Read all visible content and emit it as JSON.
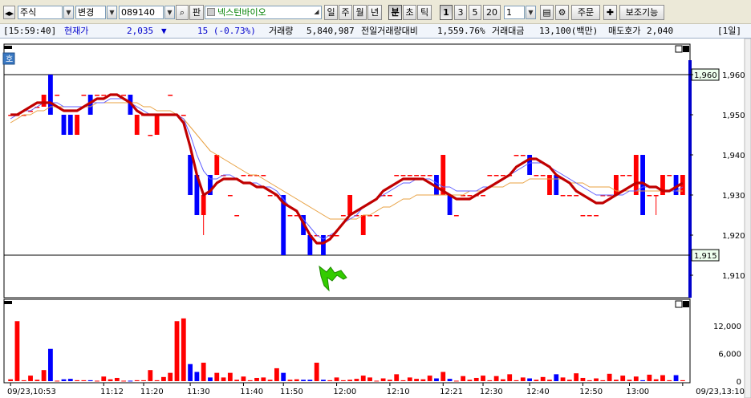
{
  "toolbar": {
    "market": "주식",
    "mode": "변경",
    "code": "089140",
    "pan": "판",
    "stock_name": "넥스턴바이오",
    "period_buttons": [
      "일",
      "주",
      "월",
      "년",
      "분",
      "초",
      "틱"
    ],
    "active_period": "분",
    "interval_buttons": [
      "1",
      "3",
      "5",
      "20"
    ],
    "active_interval": "1",
    "count_value": "1",
    "order_label": "주문",
    "aux_label": "보조기능"
  },
  "info": {
    "time": "[15:59:40]",
    "price_label": "현재가",
    "price": "2,035",
    "change_arrow": "▼",
    "change": "15 (-0.73%)",
    "volume_label": "거래량",
    "volume": "5,840,987",
    "prev_ratio_label": "전일거래량대비",
    "prev_ratio": "1,559.76%",
    "amount_label": "거래대금",
    "amount": "13,100(백만)",
    "ask_label": "매도호가",
    "ask": "2,040",
    "tab": "[1일]"
  },
  "chart_badge": "호",
  "colors": {
    "up": "#ff0000",
    "down": "#0000ff",
    "ma_main": "#c00000",
    "ma_fast": "#6060ff",
    "ma_slow": "#e8a040",
    "arrow": "#33cc00"
  },
  "chart_data": {
    "type": "candlestick",
    "price_ticks": [
      "1,960",
      "1,950",
      "1,940",
      "1,930",
      "1,920",
      "1,910"
    ],
    "price_tick_values": [
      1960,
      1950,
      1940,
      1930,
      1920,
      1910
    ],
    "hline_labels": [
      "1,960",
      "1,915"
    ],
    "hline_values": [
      1960,
      1915
    ],
    "ylim": [
      1905,
      1967
    ],
    "volume_ticks": [
      "12,000",
      "6,000",
      "0"
    ],
    "volume_tick_values": [
      12000,
      6000,
      0
    ],
    "vol_ylim": [
      0,
      16000
    ],
    "time_labels": [
      "09/23,10:53",
      "11:12",
      "11:20",
      "11:30",
      "11:40",
      "11:50",
      "12:00",
      "12:10",
      "12:21",
      "12:30",
      "12:40",
      "12:50",
      "13:00",
      "09/23,13:10"
    ],
    "time_label_index": [
      0,
      14,
      20,
      27,
      35,
      41,
      49,
      57,
      65,
      71,
      78,
      86,
      93,
      101
    ],
    "candles": [
      [
        1950,
        1950,
        1950,
        1950
      ],
      [
        1950,
        1950,
        1950,
        1950
      ],
      [
        1950,
        1950,
        1950,
        1950
      ],
      [
        1951,
        1951,
        1951,
        1951
      ],
      [
        1952,
        1952,
        1952,
        1952
      ],
      [
        1952,
        1955,
        1952,
        1955
      ],
      [
        1960,
        1960,
        1950,
        1950
      ],
      [
        1955,
        1955,
        1955,
        1955
      ],
      [
        1950,
        1950,
        1945,
        1945
      ],
      [
        1950,
        1950,
        1945,
        1945
      ],
      [
        1945,
        1950,
        1945,
        1950
      ],
      [
        1955,
        1955,
        1955,
        1955
      ],
      [
        1955,
        1955,
        1950,
        1950
      ],
      [
        1955,
        1955,
        1955,
        1955
      ],
      [
        1955,
        1955,
        1955,
        1955
      ],
      [
        1955,
        1955,
        1955,
        1955
      ],
      [
        1955,
        1955,
        1955,
        1955
      ],
      [
        1955,
        1955,
        1955,
        1955
      ],
      [
        1955,
        1955,
        1950,
        1950
      ],
      [
        1945,
        1950,
        1945,
        1950
      ],
      [
        1950,
        1950,
        1950,
        1950
      ],
      [
        1945,
        1945,
        1945,
        1945
      ],
      [
        1945,
        1950,
        1945,
        1950
      ],
      [
        1950,
        1950,
        1950,
        1950
      ],
      [
        1955,
        1955,
        1955,
        1955
      ],
      [
        1950,
        1950,
        1950,
        1950
      ],
      [
        1950,
        1950,
        1950,
        1950
      ],
      [
        1940,
        1940,
        1930,
        1930
      ],
      [
        1935,
        1935,
        1925,
        1925
      ],
      [
        1925,
        1930,
        1920,
        1930
      ],
      [
        1935,
        1935,
        1930,
        1930
      ],
      [
        1935,
        1940,
        1935,
        1940
      ],
      [
        1935,
        1935,
        1935,
        1935
      ],
      [
        1930,
        1930,
        1930,
        1930
      ],
      [
        1925,
        1925,
        1925,
        1925
      ],
      [
        1935,
        1935,
        1935,
        1935
      ],
      [
        1935,
        1935,
        1935,
        1935
      ],
      [
        1935,
        1935,
        1935,
        1935
      ],
      [
        1935,
        1935,
        1935,
        1935
      ],
      [
        1930,
        1930,
        1930,
        1930
      ],
      [
        1930,
        1930,
        1930,
        1930
      ],
      [
        1930,
        1930,
        1915,
        1915
      ],
      [
        1925,
        1925,
        1925,
        1925
      ],
      [
        1925,
        1925,
        1925,
        1925
      ],
      [
        1925,
        1925,
        1920,
        1920
      ],
      [
        1920,
        1920,
        1915,
        1915
      ],
      [
        1920,
        1920,
        1920,
        1920
      ],
      [
        1920,
        1920,
        1915,
        1915
      ],
      [
        1920,
        1920,
        1920,
        1920
      ],
      [
        1920,
        1920,
        1920,
        1920
      ],
      [
        1925,
        1925,
        1925,
        1925
      ],
      [
        1925,
        1930,
        1925,
        1930
      ],
      [
        1925,
        1925,
        1925,
        1925
      ],
      [
        1920,
        1925,
        1920,
        1925
      ],
      [
        1925,
        1925,
        1925,
        1925
      ],
      [
        1925,
        1925,
        1925,
        1925
      ],
      [
        1930,
        1930,
        1930,
        1930
      ],
      [
        1930,
        1930,
        1930,
        1930
      ],
      [
        1935,
        1935,
        1935,
        1935
      ],
      [
        1935,
        1935,
        1935,
        1935
      ],
      [
        1935,
        1935,
        1935,
        1935
      ],
      [
        1935,
        1935,
        1935,
        1935
      ],
      [
        1935,
        1935,
        1935,
        1935
      ],
      [
        1935,
        1935,
        1935,
        1935
      ],
      [
        1935,
        1935,
        1930,
        1930
      ],
      [
        1930,
        1940,
        1930,
        1940
      ],
      [
        1930,
        1930,
        1925,
        1925
      ],
      [
        1925,
        1925,
        1925,
        1925
      ],
      [
        1930,
        1930,
        1930,
        1930
      ],
      [
        1930,
        1930,
        1930,
        1930
      ],
      [
        1930,
        1930,
        1930,
        1930
      ],
      [
        1930,
        1930,
        1930,
        1930
      ],
      [
        1935,
        1935,
        1935,
        1935
      ],
      [
        1935,
        1935,
        1935,
        1935
      ],
      [
        1935,
        1935,
        1935,
        1935
      ],
      [
        1935,
        1935,
        1935,
        1935
      ],
      [
        1940,
        1940,
        1940,
        1940
      ],
      [
        1940,
        1940,
        1940,
        1940
      ],
      [
        1940,
        1940,
        1935,
        1935
      ],
      [
        1935,
        1935,
        1935,
        1935
      ],
      [
        1935,
        1935,
        1935,
        1935
      ],
      [
        1930,
        1935,
        1930,
        1935
      ],
      [
        1935,
        1935,
        1930,
        1930
      ],
      [
        1930,
        1930,
        1930,
        1930
      ],
      [
        1930,
        1930,
        1930,
        1930
      ],
      [
        1930,
        1930,
        1930,
        1930
      ],
      [
        1925,
        1925,
        1925,
        1925
      ],
      [
        1925,
        1925,
        1925,
        1925
      ],
      [
        1925,
        1925,
        1925,
        1925
      ],
      [
        1930,
        1930,
        1930,
        1930
      ],
      [
        1930,
        1930,
        1930,
        1930
      ],
      [
        1930,
        1935,
        1930,
        1935
      ],
      [
        1935,
        1935,
        1935,
        1935
      ],
      [
        1935,
        1935,
        1935,
        1935
      ],
      [
        1930,
        1940,
        1930,
        1940
      ],
      [
        1940,
        1940,
        1925,
        1925
      ],
      [
        1930,
        1930,
        1930,
        1930
      ],
      [
        1930,
        1930,
        1925,
        1930
      ],
      [
        1930,
        1935,
        1930,
        1935
      ],
      [
        1935,
        1935,
        1935,
        1935
      ],
      [
        1935,
        1935,
        1930,
        1930
      ],
      [
        1930,
        1935,
        1930,
        1935
      ]
    ],
    "volumes": [
      400,
      13000,
      200,
      1200,
      300,
      2400,
      7000,
      100,
      400,
      500,
      200,
      200,
      200,
      100,
      1000,
      400,
      700,
      100,
      100,
      200,
      200,
      2400,
      200,
      900,
      1800,
      13000,
      13600,
      3700,
      2000,
      4000,
      800,
      1800,
      800,
      1800,
      300,
      1000,
      200,
      700,
      800,
      300,
      2800,
      1800,
      300,
      400,
      300,
      300,
      4000,
      300,
      200,
      800,
      200,
      300,
      500,
      1200,
      800,
      100,
      600,
      300,
      1500,
      200,
      800,
      500,
      400,
      1200,
      600,
      2000,
      500,
      100,
      1100,
      300,
      700,
      1200,
      200,
      1100,
      400,
      1500,
      200,
      800,
      600,
      300,
      900,
      300,
      1500,
      800,
      300,
      1700,
      700,
      200,
      600,
      200,
      1600,
      300,
      1200,
      300,
      1000,
      200,
      1400,
      400,
      1300,
      200,
      1300,
      200
    ],
    "ma_main": [
      1950,
      1950,
      1951,
      1952,
      1953,
      1953,
      1953,
      1952,
      1951,
      1951,
      1951,
      1952,
      1953,
      1954,
      1954,
      1955,
      1955,
      1954,
      1953,
      1951,
      1950,
      1950,
      1950,
      1950,
      1950,
      1950,
      1948,
      1942,
      1935,
      1930,
      1931,
      1933,
      1934,
      1934,
      1934,
      1933,
      1933,
      1932,
      1932,
      1931,
      1930,
      1928,
      1927,
      1926,
      1923,
      1920,
      1918,
      1918,
      1919,
      1921,
      1923,
      1925,
      1926,
      1927,
      1928,
      1929,
      1931,
      1932,
      1933,
      1934,
      1934,
      1934,
      1934,
      1933,
      1932,
      1931,
      1930,
      1929,
      1929,
      1929,
      1930,
      1931,
      1932,
      1933,
      1934,
      1935,
      1937,
      1938,
      1939,
      1939,
      1938,
      1937,
      1935,
      1934,
      1933,
      1931,
      1930,
      1929,
      1928,
      1928,
      1929,
      1930,
      1931,
      1932,
      1933,
      1933,
      1932,
      1932,
      1931,
      1931,
      1932,
      1933
    ],
    "ma_fast": [
      1949,
      1950,
      1951,
      1951,
      1952,
      1953,
      1953,
      1953,
      1952,
      1952,
      1952,
      1952,
      1953,
      1953,
      1953,
      1954,
      1954,
      1954,
      1953,
      1952,
      1951,
      1950,
      1950,
      1950,
      1950,
      1950,
      1949,
      1945,
      1940,
      1936,
      1934,
      1934,
      1935,
      1935,
      1934,
      1933,
      1933,
      1933,
      1932,
      1932,
      1931,
      1929,
      1927,
      1926,
      1924,
      1922,
      1920,
      1919,
      1920,
      1921,
      1923,
      1924,
      1925,
      1927,
      1928,
      1929,
      1930,
      1931,
      1932,
      1933,
      1933,
      1934,
      1934,
      1934,
      1933,
      1932,
      1932,
      1931,
      1931,
      1931,
      1931,
      1932,
      1932,
      1933,
      1934,
      1935,
      1936,
      1937,
      1938,
      1938,
      1938,
      1937,
      1936,
      1935,
      1934,
      1933,
      1932,
      1931,
      1930,
      1930,
      1930,
      1930,
      1930,
      1931,
      1931,
      1932,
      1932,
      1932,
      1931,
      1931,
      1931,
      1932
    ],
    "ma_slow": [
      1948,
      1949,
      1950,
      1950,
      1951,
      1951,
      1952,
      1952,
      1952,
      1952,
      1952,
      1952,
      1952,
      1953,
      1953,
      1953,
      1953,
      1953,
      1953,
      1953,
      1952,
      1952,
      1951,
      1951,
      1951,
      1950,
      1949,
      1947,
      1945,
      1943,
      1941,
      1940,
      1939,
      1938,
      1937,
      1936,
      1935,
      1935,
      1934,
      1933,
      1932,
      1931,
      1930,
      1929,
      1928,
      1927,
      1926,
      1925,
      1924,
      1924,
      1924,
      1924,
      1924,
      1925,
      1925,
      1926,
      1927,
      1927,
      1928,
      1929,
      1929,
      1930,
      1930,
      1930,
      1930,
      1930,
      1930,
      1930,
      1930,
      1931,
      1931,
      1931,
      1932,
      1932,
      1932,
      1933,
      1933,
      1933,
      1934,
      1934,
      1934,
      1934,
      1934,
      1934,
      1933,
      1933,
      1933,
      1932,
      1932,
      1932,
      1932,
      1931,
      1931,
      1931,
      1931,
      1931,
      1931,
      1931,
      1931,
      1931,
      1931,
      1931
    ]
  }
}
